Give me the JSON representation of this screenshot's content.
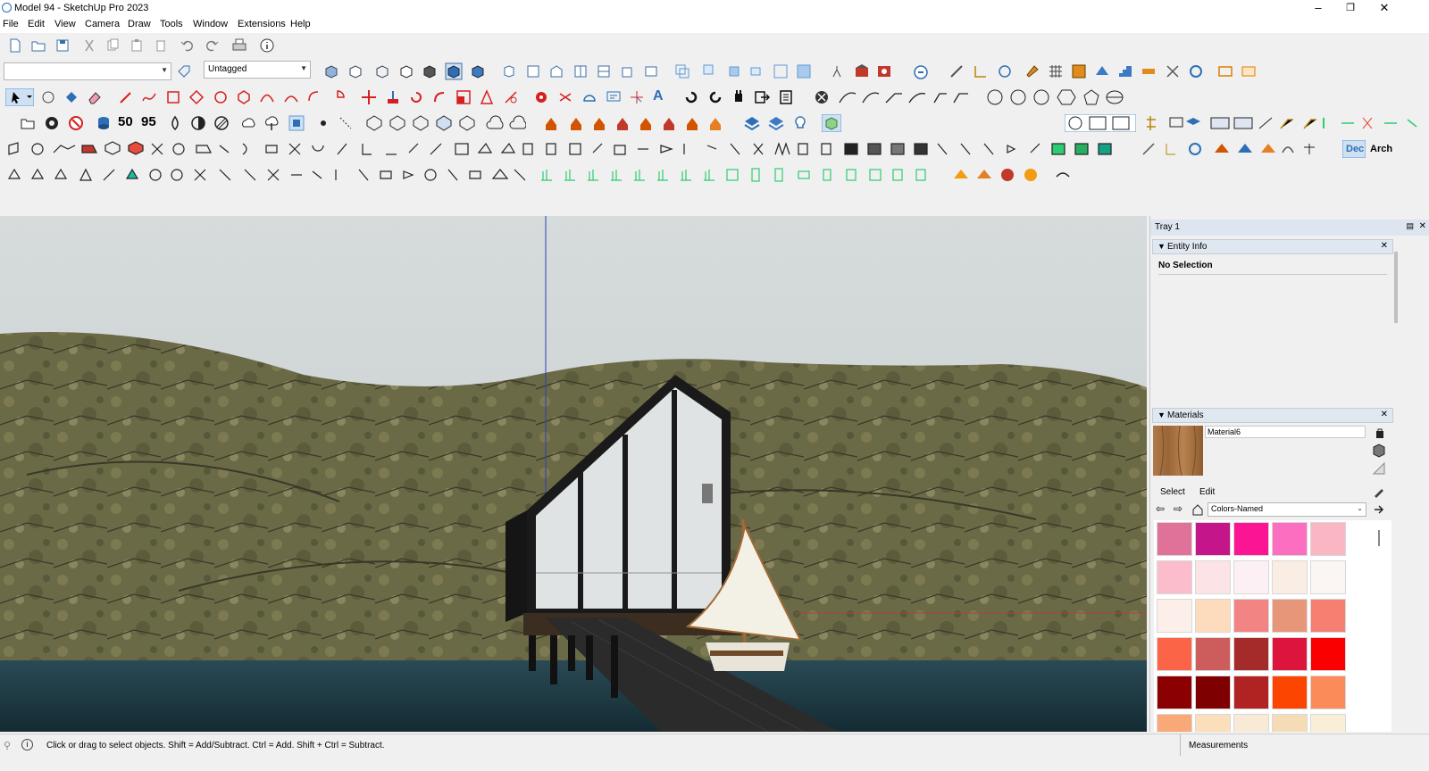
{
  "window": {
    "title": "Model 94 - SketchUp Pro 2023",
    "minimize_glyph": "–",
    "maximize_glyph": "❐",
    "close_glyph": "✕"
  },
  "menu": [
    "File",
    "Edit",
    "View",
    "Camera",
    "Draw",
    "Tools",
    "Window",
    "Extensions",
    "Help"
  ],
  "toolbar": {
    "tag_select_value": "Untagged",
    "text_tool_glyph": "A",
    "dim_label_50": "50",
    "dim_label_95": "95",
    "style_labels": [
      "Dec",
      "Arch"
    ]
  },
  "tray": {
    "title": "Tray 1",
    "entity_info": {
      "title": "Entity Info",
      "selection": "No Selection"
    },
    "materials": {
      "title": "Materials",
      "material_name": "Material6",
      "tabs": [
        "Select",
        "Edit"
      ],
      "collection": "Colors-Named",
      "swatches": [
        "#e0729a",
        "#c4168a",
        "#fb1595",
        "#fb6ec0",
        "#fbb6c4",
        "#fbbccb",
        "#fbe3e6",
        "#fcf0f4",
        "#faeee4",
        "#fbf6f4",
        "#fcefe9",
        "#fddcbd",
        "#f28584",
        "#e8967a",
        "#f77f72",
        "#fc6447",
        "#cd5d5d",
        "#a52b2b",
        "#dd143c",
        "#fb0000",
        "#8b0000",
        "#7e0000",
        "#b12222",
        "#fb4500",
        "#fb8b58",
        "#f9a878",
        "#fbdfbb",
        "#f8ead6",
        "#f6dcb6",
        "#fbeed7"
      ]
    }
  },
  "status": {
    "hint": "Click or drag to select objects. Shift = Add/Subtract. Ctrl = Add. Shift + Ctrl = Subtract.",
    "measurements_label": "Measurements"
  },
  "colors": {
    "sky": "#cfd5d6",
    "hill": "#6b6a47",
    "water": "#21404b",
    "building_frame": "#1a1a1a",
    "sail": "#f3f0e6"
  }
}
